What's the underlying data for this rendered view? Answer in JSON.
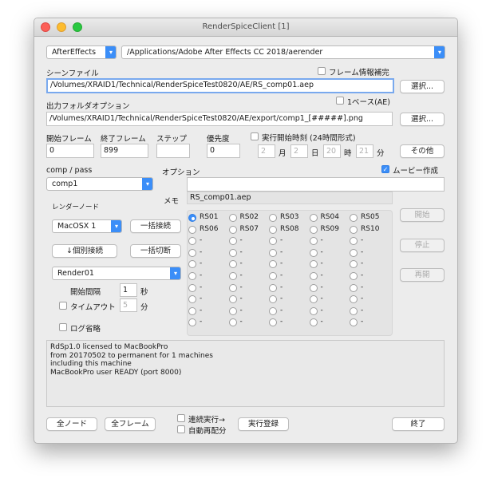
{
  "window": {
    "title": "RenderSpiceClient [1]"
  },
  "app": {
    "selected": "AfterEffects",
    "path": "/Applications/Adobe After Effects CC 2018/aerender"
  },
  "scene": {
    "label": "シーンファイル",
    "frame_info_label": "フレーム情報補完",
    "value": "/Volumes/XRAID1/Technical/RenderSpiceTest0820/AE/RS_comp01.aep",
    "select_label": "選択..."
  },
  "output": {
    "label": "出力フォルダオプション",
    "base1_label": "1ベース(AE)",
    "value": "/Volumes/XRAID1/Technical/RenderSpiceTest0820/AE/export/comp1_[#####].png",
    "select_label": "選択..."
  },
  "frames": {
    "start_label": "開始フレーム",
    "start_value": "0",
    "end_label": "終了フレーム",
    "end_value": "899",
    "step_label": "ステップ",
    "step_value": "",
    "priority_label": "優先度",
    "priority_value": "0"
  },
  "schedule": {
    "label": "実行開始時刻 (24時間形式)",
    "month": "2",
    "month_unit": "月",
    "day": "2",
    "day_unit": "日",
    "hour": "20",
    "hour_unit": "時",
    "minute": "21",
    "minute_unit": "分",
    "other_label": "その他"
  },
  "comp": {
    "label": "comp / pass",
    "selected": "comp1"
  },
  "options": {
    "label": "オプション",
    "value": "",
    "movie_label": "ムービー作成"
  },
  "memo": {
    "label": "メモ",
    "value": "RS_comp01.aep"
  },
  "render_node": {
    "label": "レンダーノード",
    "os_selected": "MacOSX 1",
    "connect_all": "一括接続",
    "connect_single": "↓個別接続",
    "disconnect_all": "一括切断",
    "node_selected": "Render01",
    "interval_label": "開始間隔",
    "interval_value": "1",
    "interval_unit": "秒",
    "timeout_label": "タイムアウト",
    "timeout_value": "5",
    "timeout_unit": "分",
    "log_omit_label": "ログ省略"
  },
  "nodes": [
    [
      "RS01",
      "RS02",
      "RS03",
      "RS04",
      "RS05"
    ],
    [
      "RS06",
      "RS07",
      "RS08",
      "RS09",
      "RS10"
    ],
    [
      "-",
      "-",
      "-",
      "-",
      "-"
    ],
    [
      "-",
      "-",
      "-",
      "-",
      "-"
    ],
    [
      "-",
      "-",
      "-",
      "-",
      "-"
    ],
    [
      "-",
      "-",
      "-",
      "-",
      "-"
    ],
    [
      "-",
      "-",
      "-",
      "-",
      "-"
    ],
    [
      "-",
      "-",
      "-",
      "-",
      "-"
    ],
    [
      "-",
      "-",
      "-",
      "-",
      "-"
    ],
    [
      "-",
      "-",
      "-",
      "-",
      "-"
    ]
  ],
  "selected_node": "RS01",
  "side": {
    "start": "開始",
    "stop": "停止",
    "resume": "再開"
  },
  "log_lines": [
    "RdSp1.0 licensed to MacBookPro",
    "from 20170502 to permanent for 1 machines",
    "including this machine",
    "MacBookPro user READY (port 8000)"
  ],
  "bottom": {
    "all_nodes": "全ノード",
    "all_frames": "全フレーム",
    "continuous": "連続実行→",
    "auto_redistribute": "自動再配分",
    "register": "実行登録",
    "quit": "終了"
  },
  "colors": {
    "accent": "#3b8ef8",
    "focus": "#79a9ee"
  }
}
